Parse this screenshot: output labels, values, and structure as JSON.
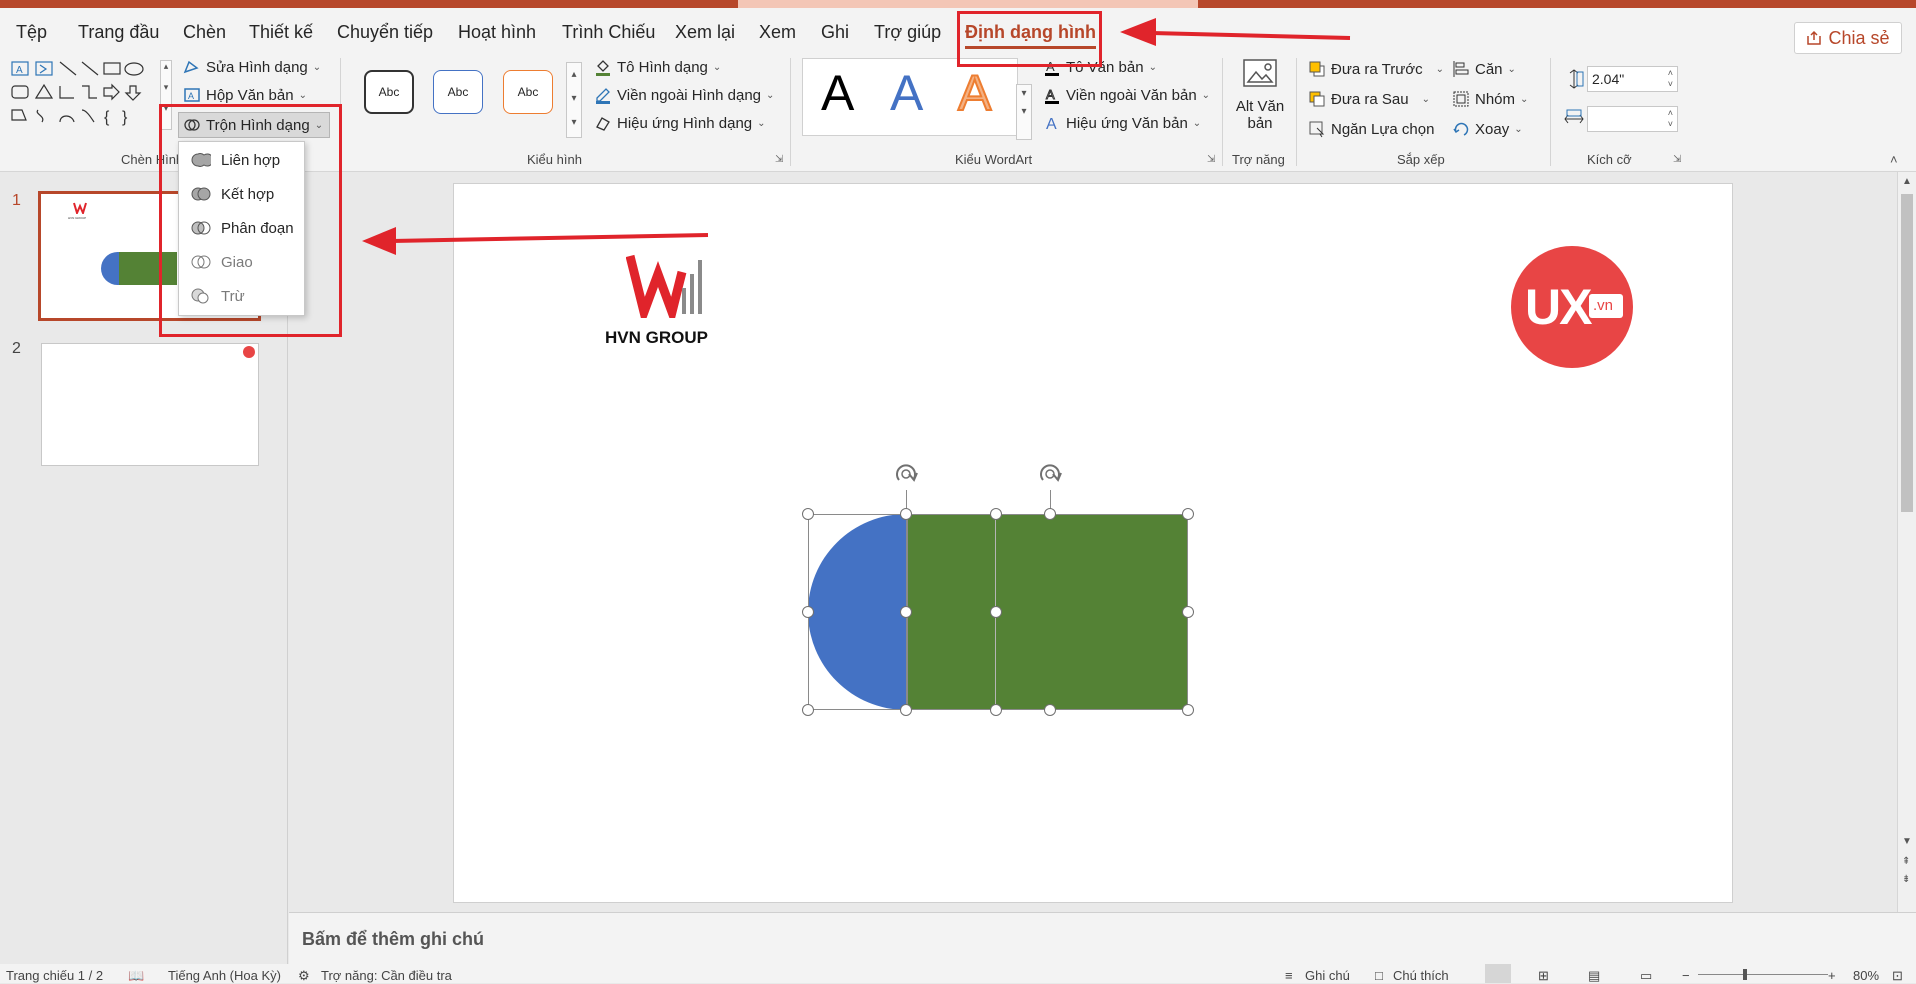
{
  "menu": {
    "tabs": [
      "Tệp",
      "Trang đầu",
      "Chèn",
      "Thiết kế",
      "Chuyển tiếp",
      "Hoạt hình",
      "Trình Chiếu",
      "Xem lại",
      "Xem",
      "Ghi",
      "Trợ giúp",
      "Định dạng hình"
    ],
    "active_tab": "Định dạng hình",
    "share_label": "Chia sẻ"
  },
  "ribbon": {
    "insert_shapes": {
      "edit_shape": "Sửa Hình dạng",
      "text_box": "Hộp Văn bản",
      "merge_shapes": "Trộn Hình dạng",
      "group_label": "Chèn Hình"
    },
    "shape_styles": {
      "style_sample": "Abc",
      "fill": "Tô Hình dạng",
      "outline": "Viền ngoài Hình dạng",
      "effects": "Hiệu ứng Hình dạng",
      "group_label": "Kiểu hình"
    },
    "wordart": {
      "sample": "A",
      "text_fill": "Tô Văn bản",
      "text_outline": "Viền ngoài Văn bản",
      "text_effects": "Hiệu ứng Văn bản",
      "group_label": "Kiểu WordArt"
    },
    "accessibility": {
      "alt_text_line1": "Alt Văn",
      "alt_text_line2": "bản",
      "group_label": "Trợ năng"
    },
    "arrange": {
      "bring_forward": "Đưa ra Trước",
      "send_backward": "Đưa ra Sau",
      "selection_pane": "Ngăn Lựa chọn",
      "align": "Căn",
      "group": "Nhóm",
      "rotate": "Xoay",
      "group_label": "Sắp xếp"
    },
    "size": {
      "height_value": "2.04\"",
      "width_value": "",
      "group_label": "Kích cỡ"
    }
  },
  "merge_dropdown": {
    "items": [
      "Liên hợp",
      "Kết hợp",
      "Phân đoạn",
      "Giao",
      "Trừ"
    ]
  },
  "thumbnails": {
    "slide1_number": "1",
    "slide2_number": "2",
    "logo_text": "HVN GROUP"
  },
  "slide": {
    "logo_text": "HVN GROUP",
    "ux_logo": "UX",
    "ux_logo_suffix": ".vn"
  },
  "notes": {
    "placeholder": "Bấm để thêm ghi chú"
  },
  "statusbar": {
    "slide_count": "Trang chiếu 1 / 2",
    "language": "Tiếng Anh (Hoa Kỳ)",
    "accessibility": "Trợ năng: Cần điều tra",
    "notes": "Ghi chú",
    "comments": "Chú thích",
    "zoom": "80%"
  },
  "colors": {
    "accent": "#b7472a",
    "annotation_red": "#e0242b",
    "shape_blue": "#4472c4",
    "shape_green": "#548235",
    "ux_red": "#e84545"
  }
}
